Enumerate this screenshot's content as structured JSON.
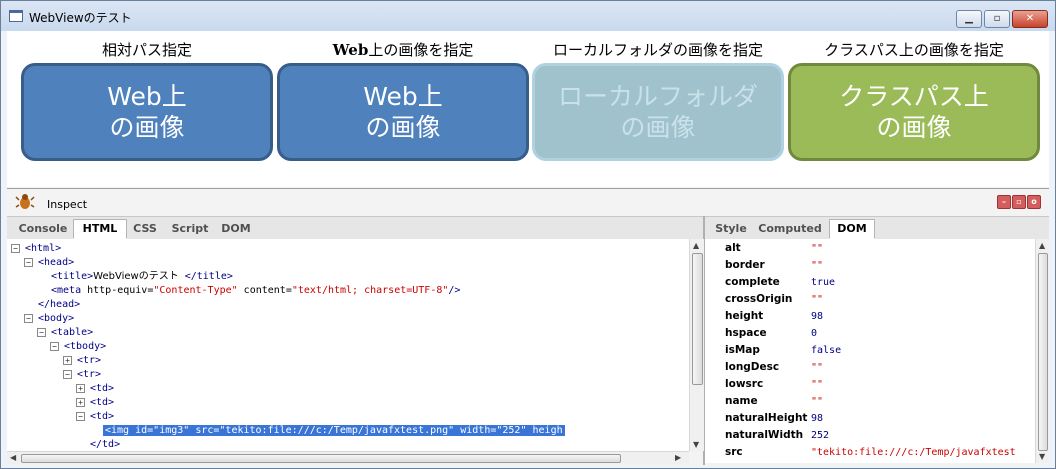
{
  "window": {
    "title": "WebViewのテスト",
    "minimize_icon": "minimize-icon",
    "maximize_icon": "maximize-icon",
    "close_icon": "close-icon"
  },
  "content": {
    "columns": [
      {
        "label": "相対パス指定",
        "tile_text": "Web上\nの画像",
        "style": "blue"
      },
      {
        "label": "Web上の画像を指定",
        "tile_text": "Web上\nの画像",
        "style": "blue"
      },
      {
        "label": "ローカルフォルダの画像を指定",
        "tile_text": "ローカルフォルダ\nの画像",
        "style": "faded"
      },
      {
        "label": "クラスパス上の画像を指定",
        "tile_text": "クラスパス上\nの画像",
        "style": "green"
      }
    ]
  },
  "inspect": {
    "title": "Inspect",
    "icon": "bug-icon",
    "left_tabs": [
      "Console",
      "HTML",
      "CSS",
      "Script",
      "DOM"
    ],
    "left_active": "HTML",
    "right_tabs": [
      "Style",
      "Computed",
      "DOM"
    ],
    "right_active": "DOM",
    "tree": [
      {
        "toggle": "−",
        "indent": 0,
        "parts": [
          [
            "tg",
            "<html>"
          ]
        ]
      },
      {
        "toggle": "−",
        "indent": 1,
        "parts": [
          [
            "tg",
            "<head>"
          ]
        ]
      },
      {
        "toggle": "",
        "indent": 2,
        "parts": [
          [
            "tg",
            "<title>"
          ],
          [
            "tx",
            "WebViewのテスト"
          ],
          [
            "tg",
            " </title>"
          ]
        ]
      },
      {
        "toggle": "",
        "indent": 2,
        "parts": [
          [
            "tg",
            "<meta "
          ],
          [
            "at",
            "http-equiv="
          ],
          [
            "av",
            "\"Content-Type\""
          ],
          [
            "at",
            " content="
          ],
          [
            "av",
            "\"text/html; charset=UTF-8\""
          ],
          [
            "tg",
            "/>"
          ]
        ]
      },
      {
        "toggle": "",
        "indent": 1,
        "parts": [
          [
            "tg",
            "</head>"
          ]
        ]
      },
      {
        "toggle": "−",
        "indent": 1,
        "parts": [
          [
            "tg",
            "<body>"
          ]
        ]
      },
      {
        "toggle": "−",
        "indent": 2,
        "parts": [
          [
            "tg",
            "<table>"
          ]
        ]
      },
      {
        "toggle": "−",
        "indent": 3,
        "parts": [
          [
            "tg",
            "<tbody>"
          ]
        ]
      },
      {
        "toggle": "+",
        "indent": 4,
        "parts": [
          [
            "tg",
            "<tr>"
          ]
        ]
      },
      {
        "toggle": "−",
        "indent": 4,
        "parts": [
          [
            "tg",
            "<tr>"
          ]
        ]
      },
      {
        "toggle": "+",
        "indent": 5,
        "parts": [
          [
            "tg",
            "<td>"
          ]
        ]
      },
      {
        "toggle": "+",
        "indent": 5,
        "parts": [
          [
            "tg",
            "<td>"
          ]
        ]
      },
      {
        "toggle": "−",
        "indent": 5,
        "parts": [
          [
            "tg",
            "<td>"
          ]
        ]
      },
      {
        "toggle": "",
        "indent": 6,
        "selected": true,
        "parts": [
          [
            "tg",
            "<img "
          ],
          [
            "at",
            "id="
          ],
          [
            "av",
            "\"img3\""
          ],
          [
            "at",
            " src="
          ],
          [
            "av",
            "\"tekito:file:///c:/Temp/javafxtest.png\""
          ],
          [
            "at",
            " width="
          ],
          [
            "av",
            "\"252\""
          ],
          [
            "at",
            " heigh"
          ]
        ]
      },
      {
        "toggle": "",
        "indent": 5,
        "parts": [
          [
            "tg",
            "</td>"
          ]
        ]
      }
    ],
    "properties": [
      {
        "name": "alt",
        "value": "\"\"",
        "kind": "str"
      },
      {
        "name": "border",
        "value": "\"\"",
        "kind": "str"
      },
      {
        "name": "complete",
        "value": "true",
        "kind": "lit"
      },
      {
        "name": "crossOrigin",
        "value": "\"\"",
        "kind": "str"
      },
      {
        "name": "height",
        "value": "98",
        "kind": "lit"
      },
      {
        "name": "hspace",
        "value": "0",
        "kind": "lit"
      },
      {
        "name": "isMap",
        "value": "false",
        "kind": "lit"
      },
      {
        "name": "longDesc",
        "value": "\"\"",
        "kind": "str"
      },
      {
        "name": "lowsrc",
        "value": "\"\"",
        "kind": "str"
      },
      {
        "name": "name",
        "value": "\"\"",
        "kind": "str"
      },
      {
        "name": "naturalHeight",
        "value": "98",
        "kind": "lit"
      },
      {
        "name": "naturalWidth",
        "value": "252",
        "kind": "lit"
      },
      {
        "name": "src",
        "value": "\"tekito:file:///c:/Temp/javafxtest",
        "kind": "str"
      }
    ]
  }
}
